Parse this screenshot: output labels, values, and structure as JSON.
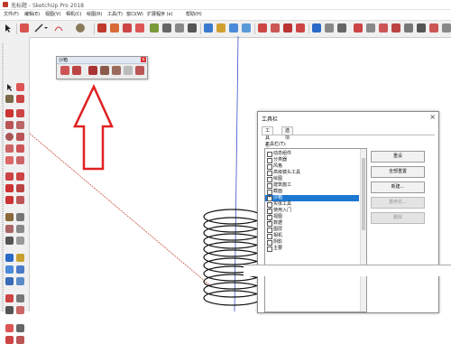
{
  "window": {
    "title": "无标题 - SketchUp Pro 2018"
  },
  "menu": [
    "文件(F)",
    "编辑(E)",
    "视图(V)",
    "相机(C)",
    "绘图(R)",
    "工具(T)",
    "窗口(W)",
    "扩展程序 (x)",
    "帮助(H)"
  ],
  "floating_palette": {
    "title": "沙箱",
    "close_label": "x"
  },
  "annotation": {
    "arrow_color": "#e02020"
  },
  "dialog": {
    "title": "工具栏",
    "close_label": "×",
    "tabs": [
      "工具栏",
      "选项"
    ],
    "list_label": "工具栏(T):",
    "items": [
      {
        "label": "动态组件",
        "checked": false
      },
      {
        "label": "分类器",
        "checked": false
      },
      {
        "label": "风格",
        "checked": false
      },
      {
        "label": "高级镜头工具",
        "checked": false
      },
      {
        "label": "绘图",
        "checked": false
      },
      {
        "label": "建筑施工",
        "checked": false
      },
      {
        "label": "截面",
        "checked": false
      },
      {
        "label": "沙箱",
        "checked": true,
        "selected": true
      },
      {
        "label": "实体工具",
        "checked": false
      },
      {
        "label": "使用入门",
        "checked": true
      },
      {
        "label": "视图",
        "checked": true
      },
      {
        "label": "数据",
        "checked": true
      },
      {
        "label": "图层",
        "checked": false
      },
      {
        "label": "相机",
        "checked": false
      },
      {
        "label": "阴影",
        "checked": false
      },
      {
        "label": "主要",
        "checked": false
      }
    ],
    "buttons": [
      {
        "label": "重设",
        "enabled": true
      },
      {
        "label": "全部重置",
        "enabled": true
      },
      {
        "label": "新建...",
        "enabled": true
      },
      {
        "label": "重命名...",
        "enabled": false
      },
      {
        "label": "删除",
        "enabled": false
      }
    ]
  },
  "colors": {
    "selection": "#1e78d2",
    "axis_red": "#c0392b",
    "axis_blue": "#3a4fc8",
    "arrow": "#e02020"
  }
}
